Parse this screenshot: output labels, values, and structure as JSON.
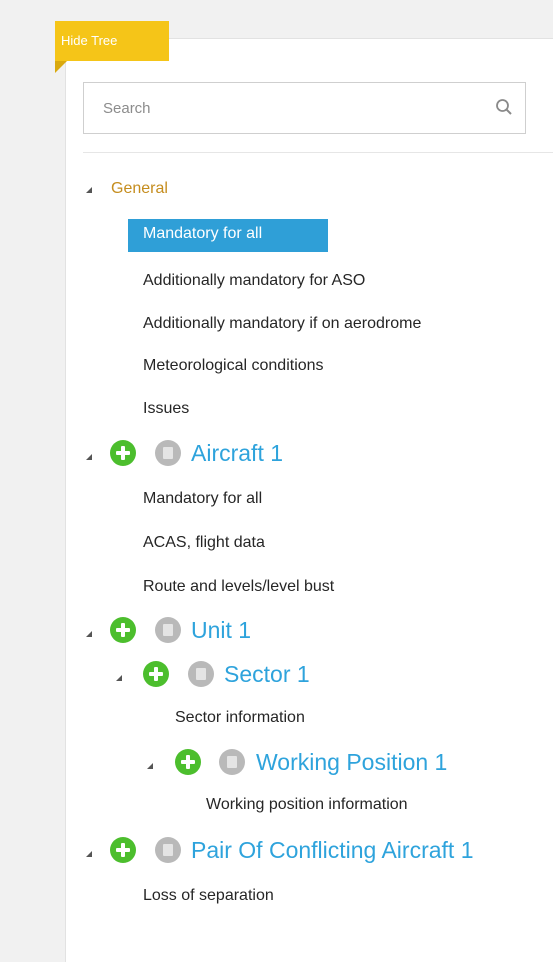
{
  "hide_tree_label": "Hide Tree",
  "search": {
    "placeholder": "Search"
  },
  "tree": {
    "general": {
      "label": "General",
      "items": [
        "Mandatory for all",
        "Additionally mandatory for ASO",
        "Additionally mandatory if on aerodrome",
        "Meteorological conditions",
        "Issues"
      ],
      "selected_item": "Mandatory for all"
    },
    "aircraft": {
      "label": "Aircraft 1",
      "items": [
        "Mandatory for all",
        "ACAS, flight data",
        "Route and levels/level bust"
      ]
    },
    "unit": {
      "label": "Unit 1"
    },
    "sector": {
      "label": "Sector 1",
      "items": [
        "Sector information"
      ]
    },
    "working_position": {
      "label": "Working Position 1",
      "items": [
        "Working position information"
      ]
    },
    "pair": {
      "label": "Pair Of Conflicting Aircraft 1",
      "items": [
        "Loss of separation"
      ]
    }
  },
  "colors": {
    "accent_blue": "#2ea3dc",
    "selected_bg": "#2f9fd7",
    "add_green": "#4cbe2d",
    "hide_tree_yellow": "#f5c518",
    "general_orange": "#c58d1e"
  },
  "icons": [
    "search-icon",
    "add-icon",
    "delete-icon",
    "collapse-arrow-icon"
  ]
}
